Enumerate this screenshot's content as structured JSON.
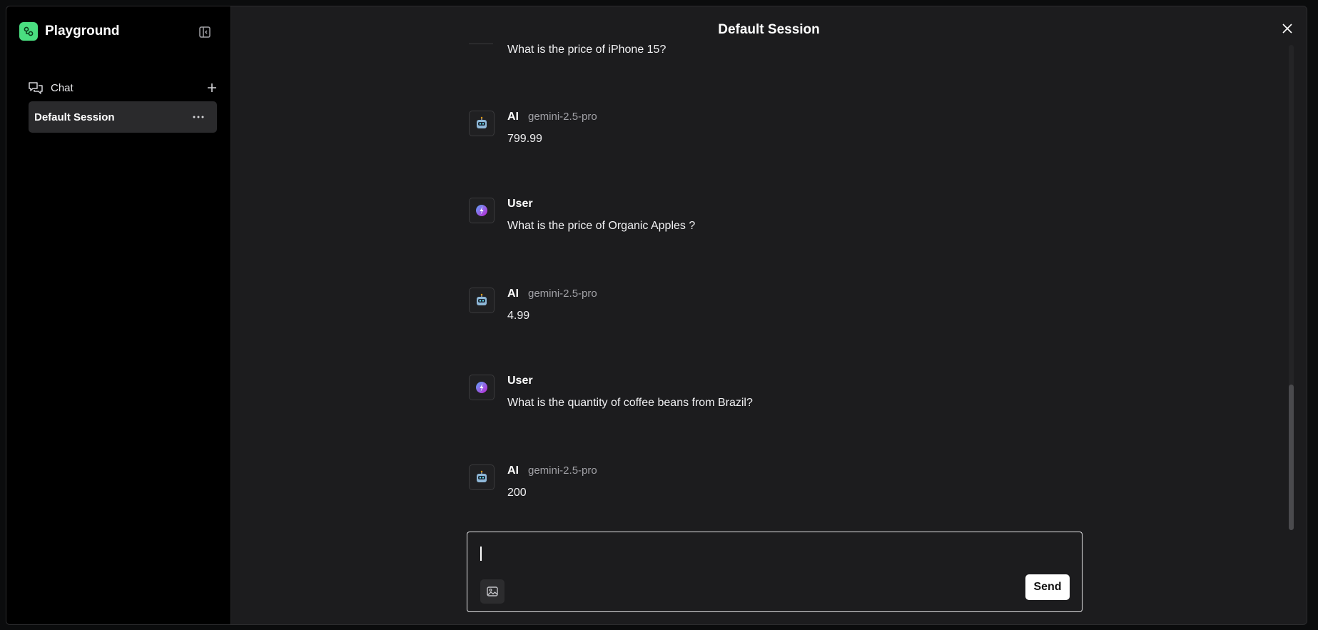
{
  "app": {
    "name": "Playground",
    "brand_color": "#4ade80"
  },
  "sidebar": {
    "nav_chat_label": "Chat",
    "sessions": [
      {
        "label": "Default Session",
        "active": true
      }
    ]
  },
  "header": {
    "title": "Default Session"
  },
  "messages": [
    {
      "role": "",
      "model": "",
      "text": "What is the price of iPhone 15?",
      "avatar": "user-icon"
    },
    {
      "role": "AI",
      "model": "gemini-2.5-pro",
      "text": "799.99",
      "avatar": "robot-icon"
    },
    {
      "role": "User",
      "model": "",
      "text": "What is the price of Organic Apples ?",
      "avatar": "user-icon"
    },
    {
      "role": "AI",
      "model": "gemini-2.5-pro",
      "text": "4.99",
      "avatar": "robot-icon"
    },
    {
      "role": "User",
      "model": "",
      "text": "What is the quantity of coffee beans from Brazil?",
      "avatar": "user-icon"
    },
    {
      "role": "AI",
      "model": "gemini-2.5-pro",
      "text": "200",
      "avatar": "robot-icon"
    }
  ],
  "composer": {
    "value": "",
    "send_label": "Send"
  }
}
